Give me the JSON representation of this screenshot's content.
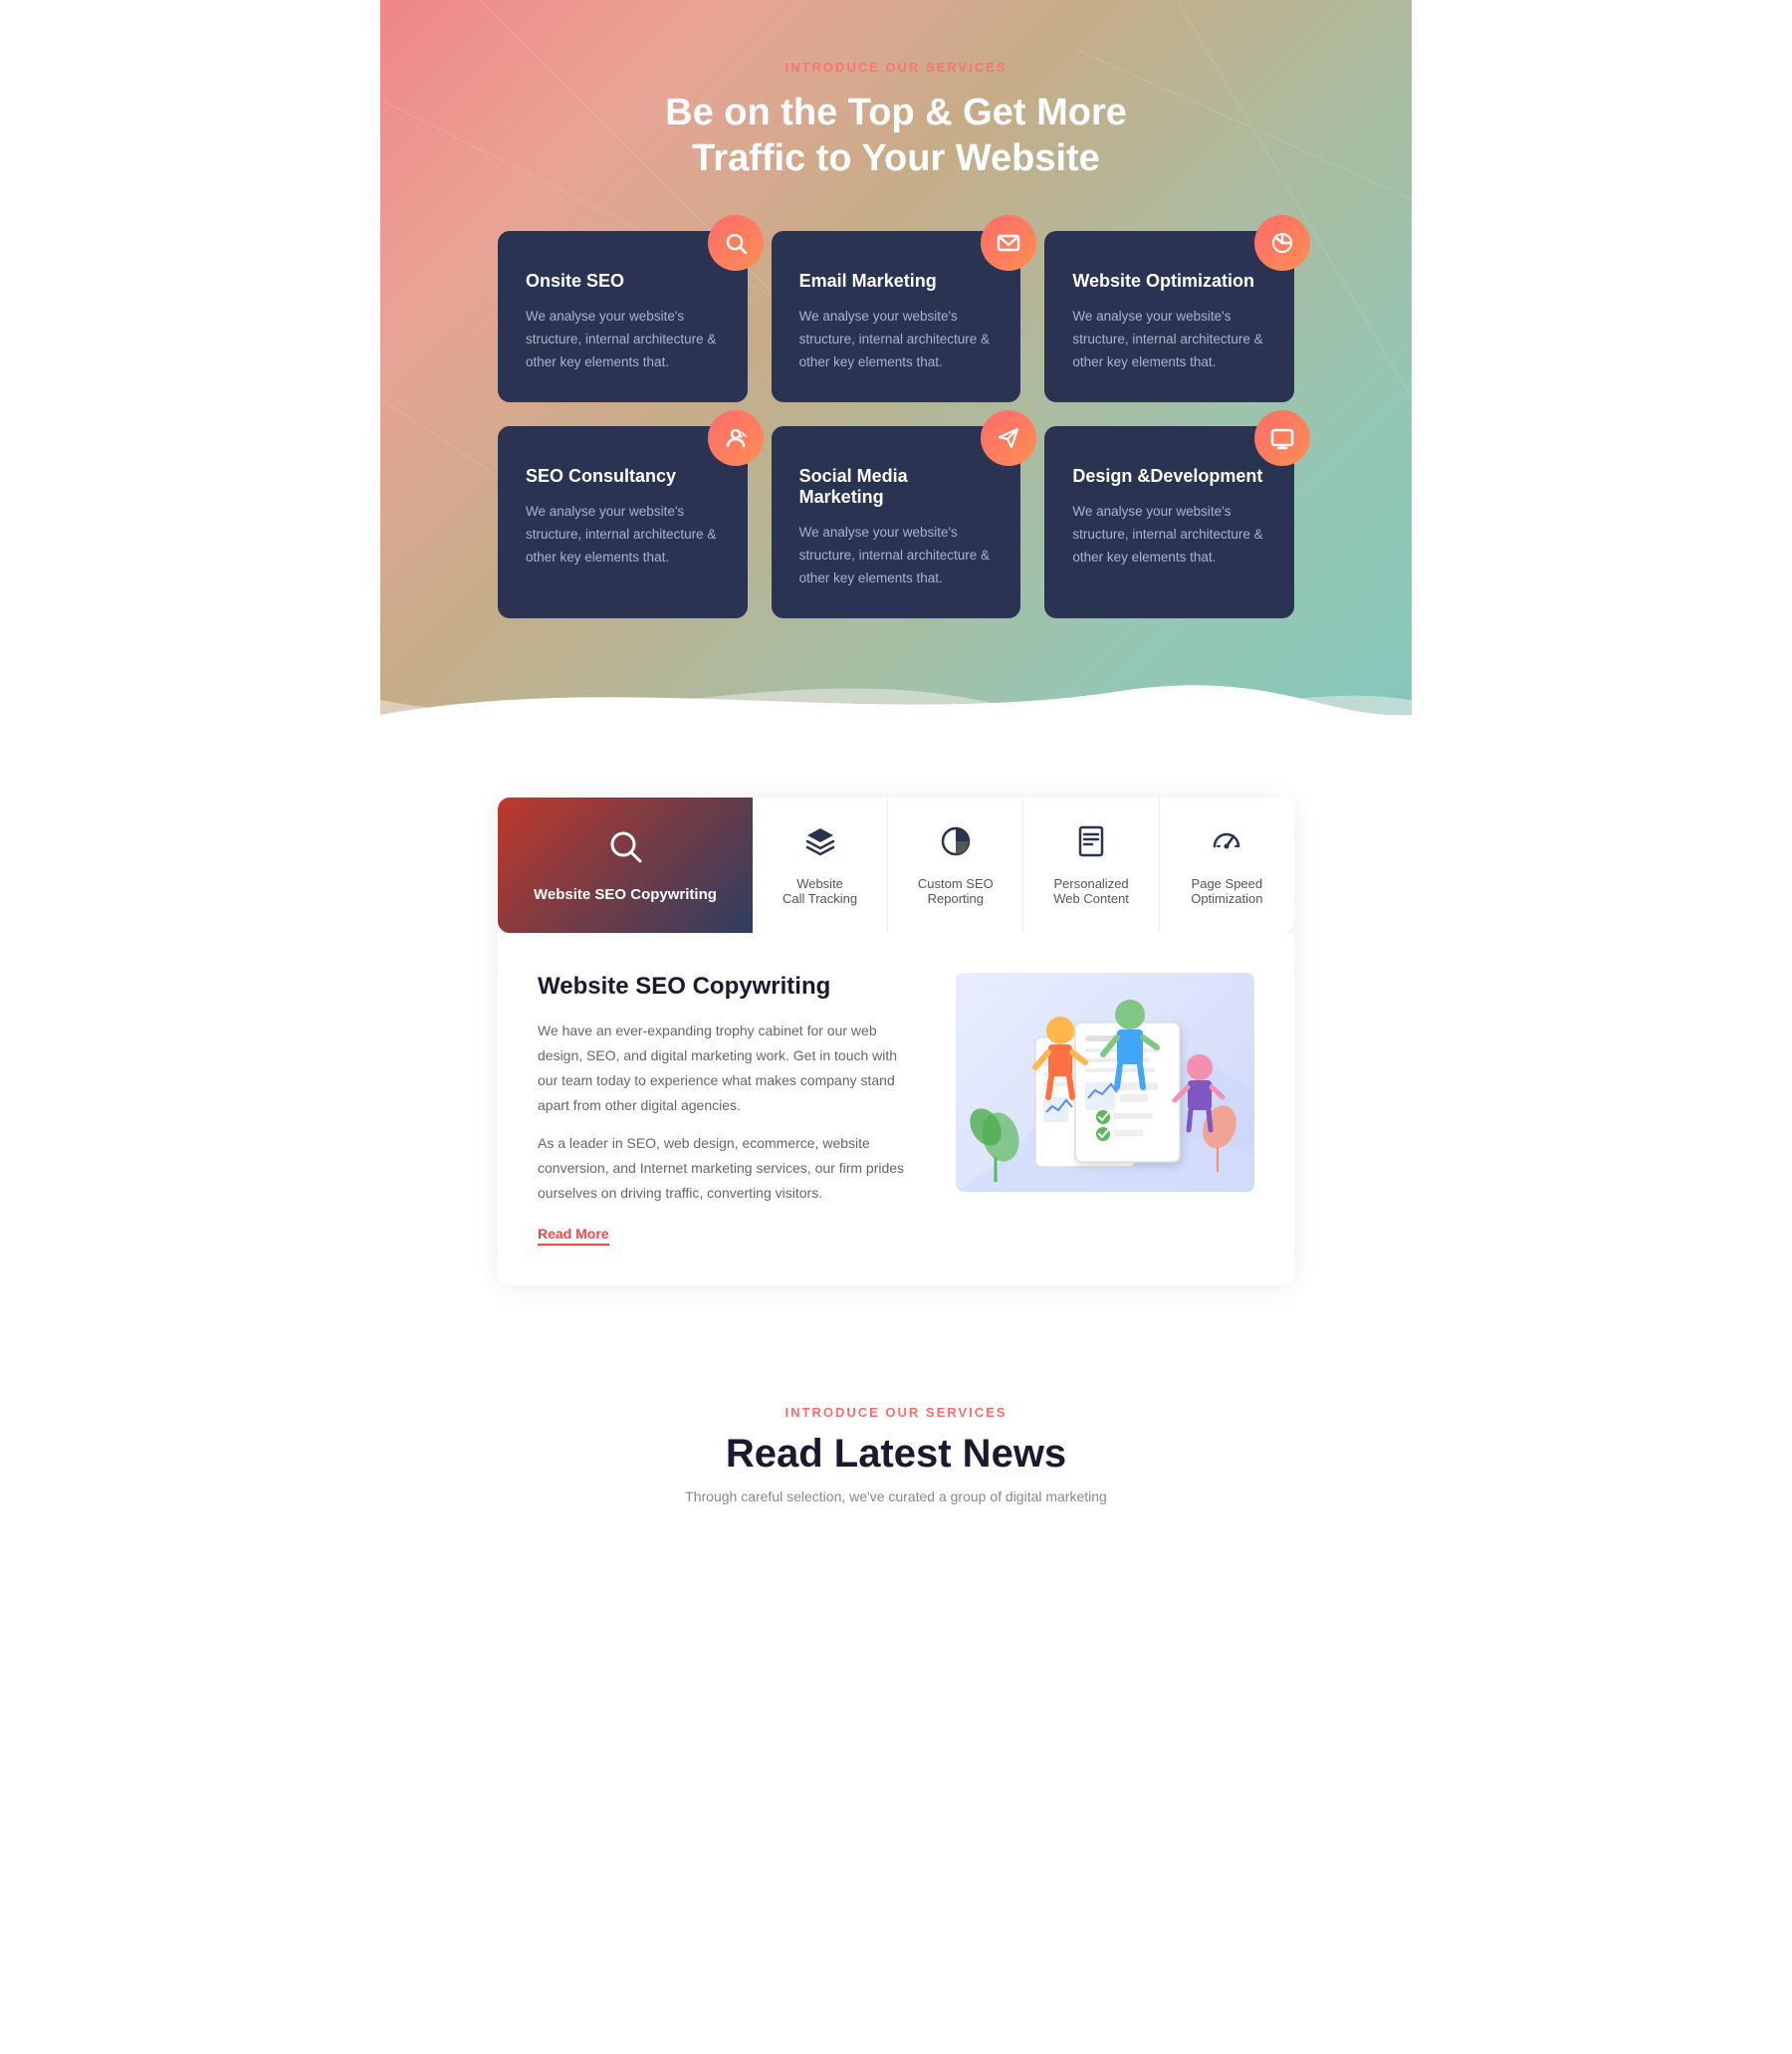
{
  "services_section": {
    "subtitle": "INTRODUCE OUR SERVICES",
    "title_line1": "Be on the Top & Get More",
    "title_line2": "Traffic to Your Website",
    "cards": [
      {
        "id": "onsite-seo",
        "title": "Onsite SEO",
        "description": "We analyse your website's structure, internal architecture & other key elements that.",
        "icon": "🔍"
      },
      {
        "id": "email-marketing",
        "title": "Email Marketing",
        "description": "We analyse your website's structure, internal architecture & other key elements that.",
        "icon": "✉"
      },
      {
        "id": "website-optimization",
        "title": "Website Optimization",
        "description": "We analyse your website's structure, internal architecture & other key elements that.",
        "icon": "📊"
      },
      {
        "id": "seo-consultancy",
        "title": "SEO Consultancy",
        "description": "We analyse your website's structure, internal architecture & other key elements that.",
        "icon": "👤"
      },
      {
        "id": "social-media-marketing",
        "title": "Social Media Marketing",
        "description": "We analyse your website's structure, internal architecture & other key elements that.",
        "icon": "📣"
      },
      {
        "id": "design-development",
        "title": "Design &Development",
        "description": "We analyse your website's structure, internal architecture & other key elements that.",
        "icon": "💻"
      }
    ]
  },
  "features_tabs": {
    "active_tab": {
      "label": "Website SEO Copywriting",
      "icon": "search"
    },
    "inactive_tabs": [
      {
        "id": "website-call-tracking",
        "label": "Website\nCall Tracking",
        "icon": "layers"
      },
      {
        "id": "custom-seo-reporting",
        "label": "Custom SEO\nReporting",
        "icon": "pie-chart"
      },
      {
        "id": "personalized-web-content",
        "label": "Personalized\nWeb Content",
        "icon": "document"
      },
      {
        "id": "page-speed-optimization",
        "label": "Page Speed\nOptimization",
        "icon": "speedometer"
      }
    ]
  },
  "content_card": {
    "title": "Website SEO Copywriting",
    "description1": "We have an ever-expanding trophy cabinet for our web design, SEO, and digital marketing work. Get in touch with our team today to experience what makes company stand apart from other digital agencies.",
    "description2": "As a leader in SEO, web design, ecommerce, website conversion, and Internet marketing services, our firm prides ourselves on driving traffic, converting visitors.",
    "read_more": "Read More"
  },
  "news_section": {
    "subtitle": "INTRODUCE OUR SERVICES",
    "title": "Read Latest News",
    "description": "Through careful selection, we've curated a group of digital marketing"
  }
}
